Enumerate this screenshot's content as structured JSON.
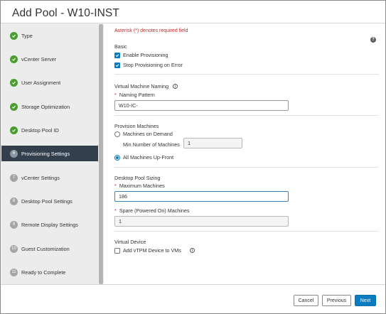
{
  "dialog": {
    "title": "Add Pool - W10-INST"
  },
  "sidebar": {
    "steps": [
      {
        "label": "Type",
        "state": "done"
      },
      {
        "label": "vCenter Server",
        "state": "done"
      },
      {
        "label": "User Assignment",
        "state": "done"
      },
      {
        "label": "Storage Optimization",
        "state": "done"
      },
      {
        "label": "Desktop Pool ID",
        "state": "done"
      },
      {
        "number": "6",
        "label": "Provisioning Settings",
        "state": "active"
      },
      {
        "number": "7",
        "label": "vCenter Settings",
        "state": "pending"
      },
      {
        "number": "8",
        "label": "Desktop Pool Settings",
        "state": "pending"
      },
      {
        "number": "9",
        "label": "Remote Display Settings",
        "state": "pending"
      },
      {
        "number": "10",
        "label": "Guest Customization",
        "state": "pending"
      },
      {
        "number": "11",
        "label": "Ready to Complete",
        "state": "pending"
      }
    ]
  },
  "form": {
    "required_note": "Asterisk (*) denotes required field",
    "help_icon": "?",
    "basic": {
      "heading": "Basic",
      "enable_provisioning": {
        "label": "Enable Provisioning",
        "checked": true
      },
      "stop_on_error": {
        "label": "Stop Provisioning on Error",
        "checked": true
      }
    },
    "vm_naming": {
      "heading": "Virtual Machine Naming",
      "info_icon": "i",
      "required_star": "*",
      "pattern_label": "Naming Pattern",
      "pattern_value": "W10-IC-"
    },
    "provision_machines": {
      "heading": "Provision Machines",
      "on_demand_label": "Machines on Demand",
      "min_label": "Min Number of Machines",
      "min_value": "1",
      "upfront_label": "All Machines Up-Front",
      "selected": "upfront"
    },
    "sizing": {
      "heading": "Desktop Pool Sizing",
      "required_star": "*",
      "max_label": "Maximum Machines",
      "max_value": "186",
      "spare_label": "Spare (Powered On) Machines",
      "spare_value": "1"
    },
    "virtual_device": {
      "heading": "Virtual Device",
      "vtpm_label": "Add vTPM Device to VMs",
      "vtpm_checked": false,
      "info_icon": "i"
    }
  },
  "footer": {
    "cancel_label": "Cancel",
    "previous_label": "Previous",
    "next_label": "Next"
  },
  "colors": {
    "accent": "#0a7cc2",
    "done": "#4a9d2e",
    "active_step_bg": "#333f4c",
    "required": "#c52b2b"
  }
}
